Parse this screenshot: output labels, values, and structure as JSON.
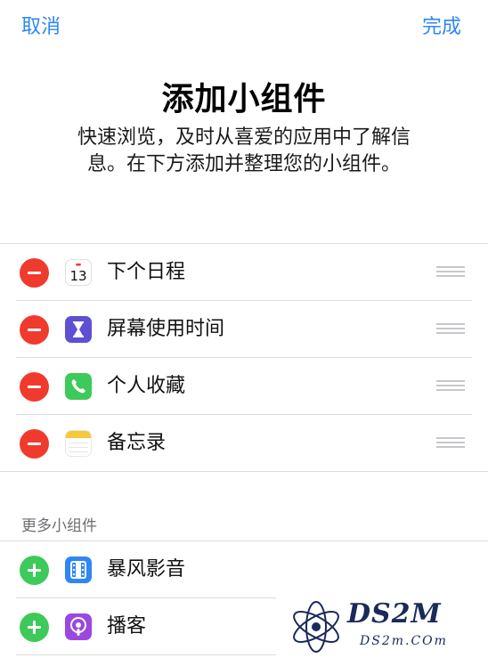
{
  "nav": {
    "cancel_label": "取消",
    "done_label": "完成"
  },
  "header": {
    "title": "添加小组件",
    "description_line1": "快速浏览，及时从喜爱的应用中了解信",
    "description_line2": "息。在下方添加并整理您的小组件。"
  },
  "active_widgets": [
    {
      "label": "下个日程",
      "icon": "calendar-icon",
      "calendar_day": "13"
    },
    {
      "label": "屏幕使用时间",
      "icon": "hourglass-icon"
    },
    {
      "label": "个人收藏",
      "icon": "phone-icon"
    },
    {
      "label": "备忘录",
      "icon": "notes-icon"
    }
  ],
  "more": {
    "header": "更多小组件",
    "items": [
      {
        "label": "暴风影音",
        "icon": "film-icon"
      },
      {
        "label": "播客",
        "icon": "podcast-icon"
      }
    ]
  },
  "watermark": {
    "brand": "DS2M",
    "url": "DS2m.COm"
  },
  "colors": {
    "accent": "#2f86f6",
    "delete": "#f03a2e",
    "add": "#3ec95b"
  }
}
